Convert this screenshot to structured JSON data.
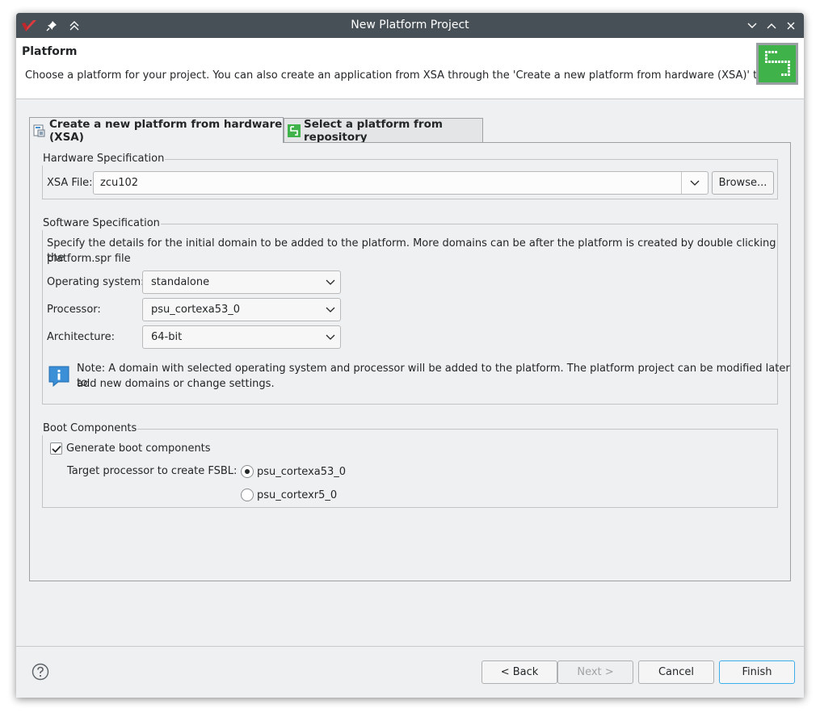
{
  "window": {
    "title": "New Platform Project"
  },
  "header": {
    "title": "Platform",
    "description": "Choose a platform for your project. You can also create an application from XSA through the 'Create a new platform from hardware (XSA)' tab."
  },
  "tabs": [
    {
      "label": "Create a new platform from hardware (XSA)",
      "active": true
    },
    {
      "label": "Select a platform from repository",
      "active": false
    }
  ],
  "hardware": {
    "legend": "Hardware Specification",
    "xsa_label": "XSA File:",
    "xsa_value": "zcu102",
    "browse_label": "Browse..."
  },
  "software": {
    "legend": "Software Specification",
    "description_line1": "Specify the details for the initial domain to be added to the platform. More domains can be after the platform is created by double clicking the",
    "description_line2": "platform.spr file",
    "os_label": "Operating system:",
    "os_value": "standalone",
    "processor_label": "Processor:",
    "processor_value": "psu_cortexa53_0",
    "arch_label": "Architecture:",
    "arch_value": "64-bit",
    "note_line1": "Note: A domain with selected operating system and processor will be added to the platform. The platform project can be modified later to",
    "note_line2": "add new domains or change settings."
  },
  "boot": {
    "legend": "Boot Components",
    "generate_label": "Generate boot components",
    "generate_checked": true,
    "target_label": "Target processor to create FSBL:",
    "options": [
      {
        "label": "psu_cortexa53_0",
        "selected": true
      },
      {
        "label": "psu_cortexr5_0",
        "selected": false
      }
    ]
  },
  "footer": {
    "back_label": "< Back",
    "next_label": "Next >",
    "cancel_label": "Cancel",
    "finish_label": "Finish"
  },
  "colors": {
    "titlebar": "#475057",
    "accent": "#3daee9",
    "brand_green": "#3fb24a"
  }
}
